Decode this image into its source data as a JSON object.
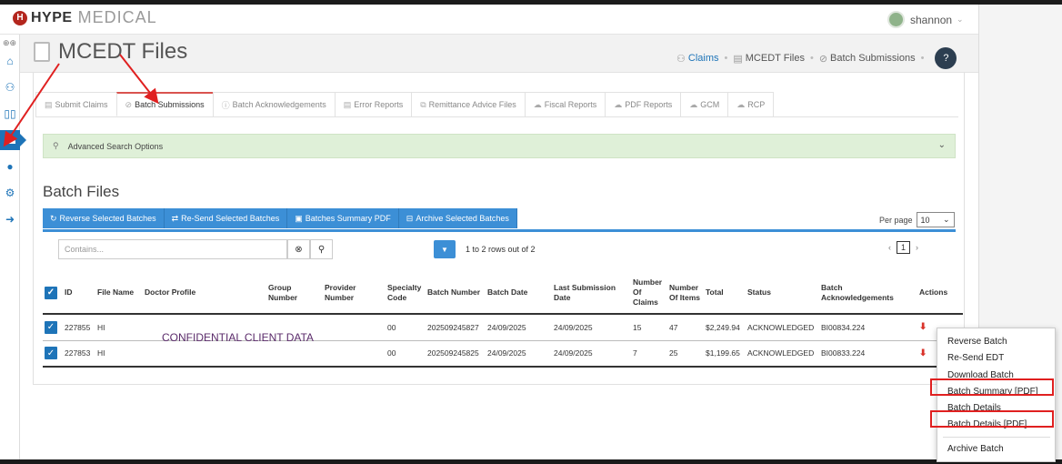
{
  "app": {
    "logo_mark": "H",
    "logo_text1": "HYPE",
    "logo_text2": "MEDICAL",
    "user_name": "shannon"
  },
  "header": {
    "title": "MCEDT Files",
    "breadcrumbs": [
      "Claims",
      "MCEDT Files",
      "Batch Submissions"
    ],
    "help_label": "?"
  },
  "tabs": [
    {
      "label": "Submit Claims",
      "active": false
    },
    {
      "label": "Batch Submissions",
      "active": true
    },
    {
      "label": "Batch Acknowledgements",
      "active": false
    },
    {
      "label": "Error Reports",
      "active": false
    },
    {
      "label": "Remittance Advice Files",
      "active": false
    },
    {
      "label": "Fiscal Reports",
      "active": false
    },
    {
      "label": "PDF Reports",
      "active": false
    },
    {
      "label": "GCM",
      "active": false
    },
    {
      "label": "RCP",
      "active": false
    }
  ],
  "search": {
    "label": "Advanced Search Options"
  },
  "section": {
    "title": "Batch Files"
  },
  "actions": {
    "reverse": "Reverse Selected Batches",
    "resend": "Re-Send Selected Batches",
    "summary": "Batches Summary PDF",
    "archive": "Archive Selected Batches"
  },
  "perpage": {
    "label": "Per page",
    "value": "10"
  },
  "grid": {
    "filter_placeholder": "Contains...",
    "rows_info": "1 to 2 rows out of 2",
    "page": "1",
    "columns": [
      "ID",
      "File Name",
      "Doctor Profile",
      "Group Number",
      "Provider Number",
      "Specialty Code",
      "Batch Number",
      "Batch Date",
      "Last Submission Date",
      "Number Of Claims",
      "Number Of Items",
      "Total",
      "Status",
      "Batch Acknowledgements",
      "Actions"
    ],
    "rows": [
      {
        "id": "227855",
        "file": "HI",
        "doctor": "",
        "group": "",
        "provider": "",
        "specialty": "00",
        "batch": "202509245827",
        "batch_date": "24/09/2025",
        "last_sub": "24/09/2025",
        "claims": "15",
        "items": "47",
        "total": "$2,249.94",
        "status": "ACKNOWLEDGED",
        "ack": "BI00834.224"
      },
      {
        "id": "227853",
        "file": "HI",
        "doctor": "",
        "group": "",
        "provider": "",
        "specialty": "00",
        "batch": "202509245825",
        "batch_date": "24/09/2025",
        "last_sub": "24/09/2025",
        "claims": "7",
        "items": "25",
        "total": "$1,199.65",
        "status": "ACKNOWLEDGED",
        "ack": "BI00833.224"
      }
    ]
  },
  "overlay": {
    "confidential": "CONFIDENTIAL CLIENT DATA"
  },
  "menu": {
    "items": [
      "Reverse Batch",
      "Re-Send EDT",
      "Download Batch",
      "Batch Summary [PDF]",
      "Batch Details",
      "Batch Details [PDF]",
      "Archive Batch"
    ],
    "highlighted": [
      "Batch Summary [PDF]",
      "Batch Details [PDF]"
    ]
  },
  "colors": {
    "primary": "#3c8fd6",
    "annotation": "#e02020",
    "search_bg": "#dff0d8"
  }
}
